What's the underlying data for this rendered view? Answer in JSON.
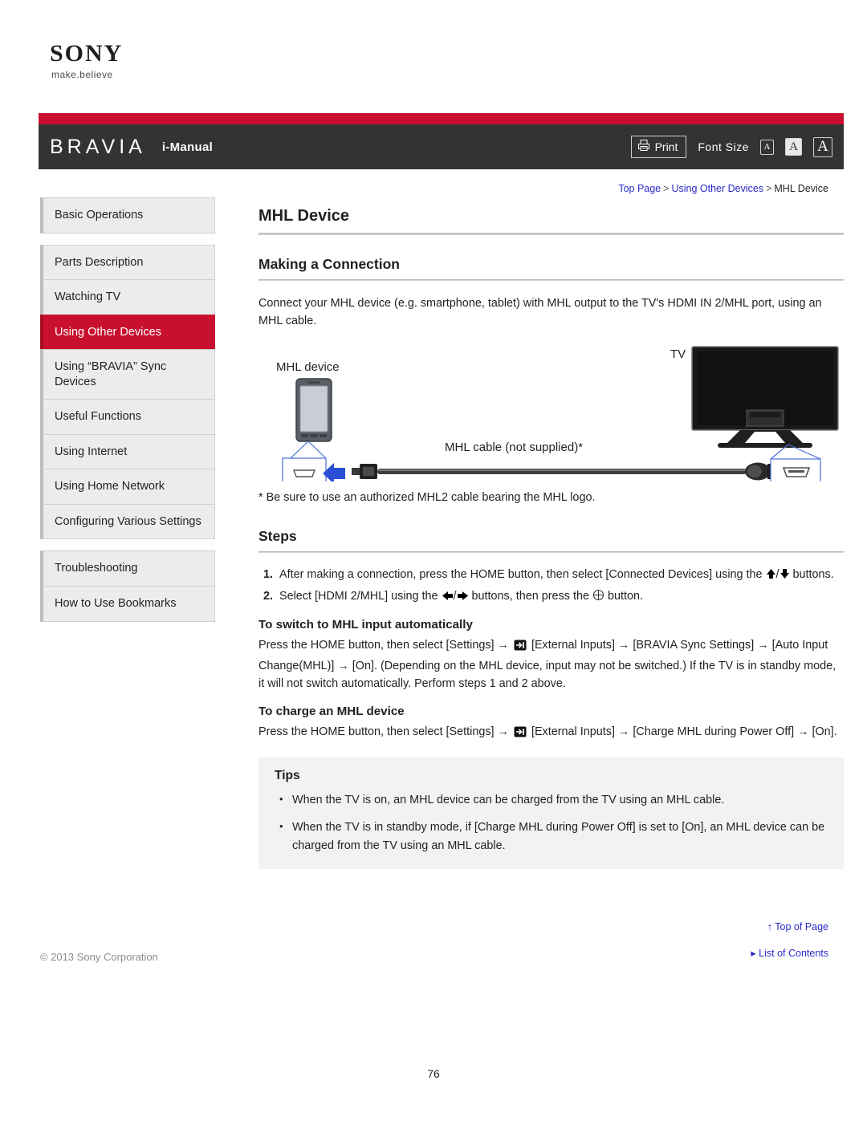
{
  "brand": {
    "logo_text": "SONY",
    "tagline": "make.believe"
  },
  "header": {
    "product": "BRAVIA",
    "manual_label": "i-Manual",
    "print_label": "Print",
    "font_size_label": "Font Size",
    "font_size_options": [
      "A",
      "A",
      "A"
    ],
    "font_size_selected": "A",
    "colors": {
      "accent_red": "#c8102e",
      "bar_dark": "#333333"
    }
  },
  "breadcrumb": {
    "items": [
      "Top Page",
      "Using Other Devices",
      "MHL Device"
    ],
    "separator": ">"
  },
  "sidebar": {
    "groups": [
      {
        "items": [
          {
            "label": "Basic Operations",
            "active": false
          }
        ]
      },
      {
        "items": [
          {
            "label": "Parts Description",
            "active": false
          },
          {
            "label": "Watching TV",
            "active": false
          },
          {
            "label": "Using Other Devices",
            "active": true
          },
          {
            "label": "Using “BRAVIA” Sync Devices",
            "active": false
          },
          {
            "label": "Useful Functions",
            "active": false
          },
          {
            "label": "Using Internet",
            "active": false
          },
          {
            "label": "Using Home Network",
            "active": false
          },
          {
            "label": "Configuring Various Settings",
            "active": false
          }
        ]
      },
      {
        "items": [
          {
            "label": "Troubleshooting",
            "active": false
          },
          {
            "label": "How to Use Bookmarks",
            "active": false
          }
        ]
      }
    ]
  },
  "main": {
    "title": "MHL Device",
    "section_connection": {
      "heading": "Making a Connection",
      "body": "Connect your MHL device (e.g. smartphone, tablet) with MHL output to the TV's HDMI IN 2/MHL port, using an MHL cable."
    },
    "figure": {
      "label_device": "MHL device",
      "label_tv": "TV",
      "label_cable": "MHL cable (not supplied)*"
    },
    "footnote": "* Be sure to use an authorized MHL2 cable bearing the MHL logo.",
    "section_steps": {
      "heading": "Steps",
      "items": [
        {
          "number": "1.",
          "text_before": "After making a connection, press the HOME button, then select [Connected Devices] using the ",
          "icons": "up-down-arrow-buttons",
          "text_after": " buttons."
        },
        {
          "number": "2.",
          "text_before": "Select [HDMI 2/MHL] using the ",
          "icons": "left-right-arrow-buttons",
          "text_mid": " buttons, then press the ",
          "icons2": "enter-button",
          "text_after": " button."
        }
      ]
    },
    "section_auto_switch": {
      "heading": "To switch to MHL input automatically",
      "text_before": "Press the HOME button, then select [Settings] → ",
      "icon": "external-inputs-icon",
      "text_after": " [External Inputs] → [BRAVIA Sync Settings] → [Auto Input Change(MHL)] → [On]. (Depending on the MHL device, input may not be switched.) If the TV is in standby mode, it will not switch automatically. Perform steps 1 and 2 above."
    },
    "section_charge": {
      "heading": "To charge an MHL device",
      "text_before": "Press the HOME button, then select [Settings] → ",
      "icon": "external-inputs-icon",
      "text_after": " [External Inputs] → [Charge MHL during Power Off] → [On]."
    },
    "tips": {
      "heading": "Tips",
      "items": [
        "When the TV is on, an MHL device can be charged from the TV using an MHL cable.",
        "When the TV is in standby mode, if [Charge MHL during Power Off] is set to [On], an MHL device can be charged from the TV using an MHL cable."
      ]
    }
  },
  "footer": {
    "top_of_page": "↑ Top of Page",
    "list_of_contents": "▸ List of Contents",
    "copyright": "© 2013 Sony Corporation",
    "page_number": "76"
  }
}
